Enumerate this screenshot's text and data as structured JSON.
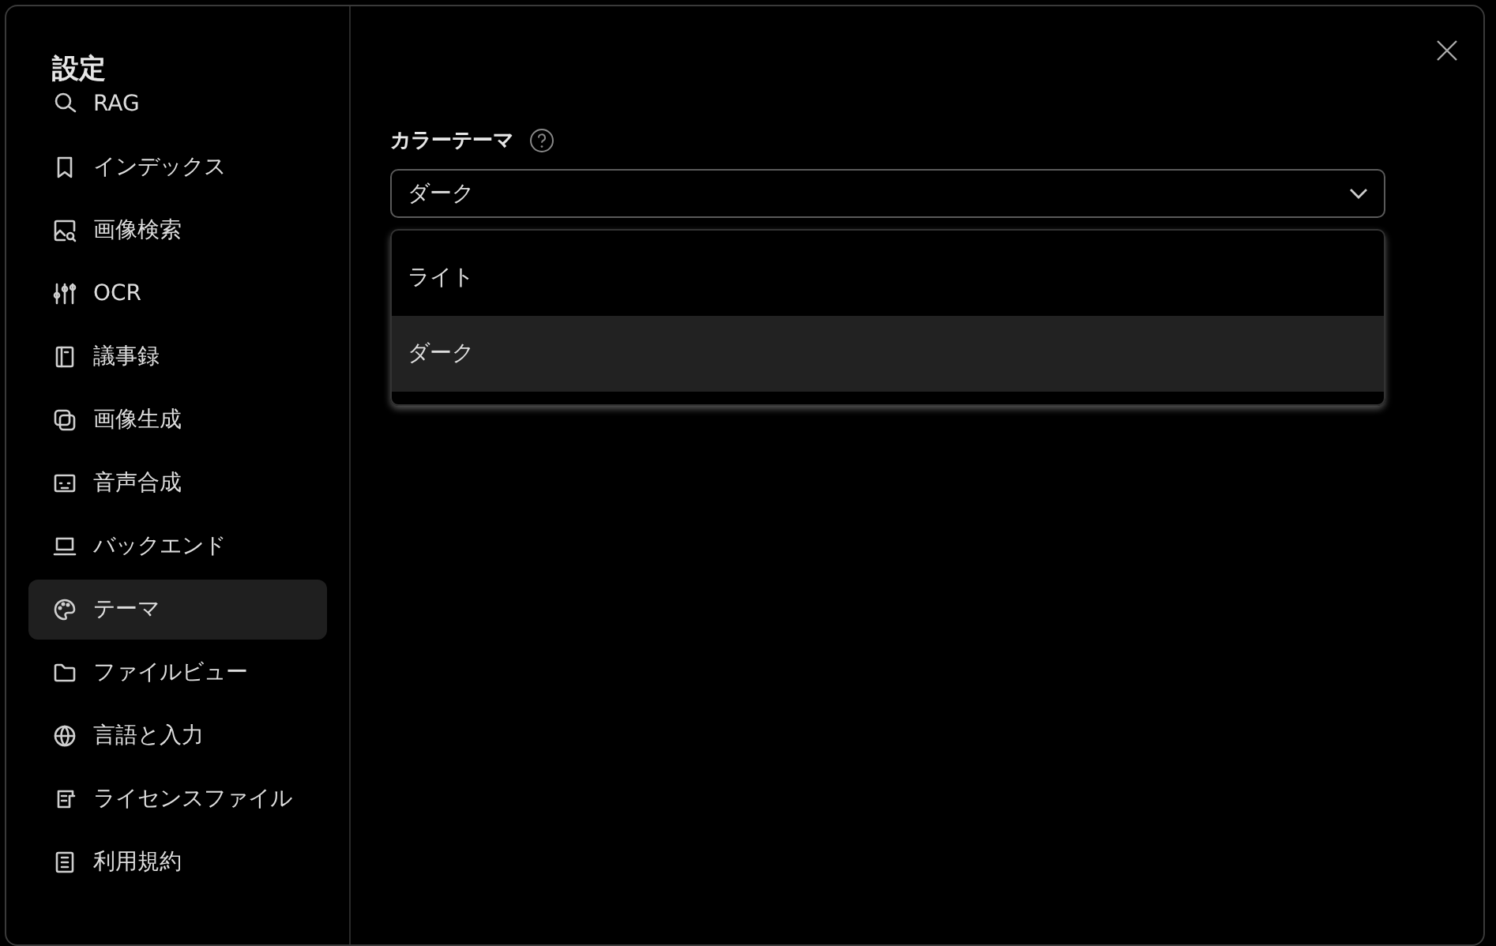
{
  "sidebar": {
    "title": "設定",
    "items": [
      {
        "label": "RAG",
        "selected": false
      },
      {
        "label": "インデックス",
        "selected": false
      },
      {
        "label": "画像検索",
        "selected": false
      },
      {
        "label": "OCR",
        "selected": false
      },
      {
        "label": "議事録",
        "selected": false
      },
      {
        "label": "画像生成",
        "selected": false
      },
      {
        "label": "音声合成",
        "selected": false
      },
      {
        "label": "バックエンド",
        "selected": false
      },
      {
        "label": "テーマ",
        "selected": true
      },
      {
        "label": "ファイルビュー",
        "selected": false
      },
      {
        "label": "言語と入力",
        "selected": false
      },
      {
        "label": "ライセンスファイル",
        "selected": false
      },
      {
        "label": "利用規約",
        "selected": false
      }
    ]
  },
  "theme_setting": {
    "label": "カラーテーマ",
    "value": "ダーク",
    "expanded": true,
    "options": [
      {
        "label": "ライト",
        "selected": false
      },
      {
        "label": "ダーク",
        "selected": true
      }
    ]
  }
}
